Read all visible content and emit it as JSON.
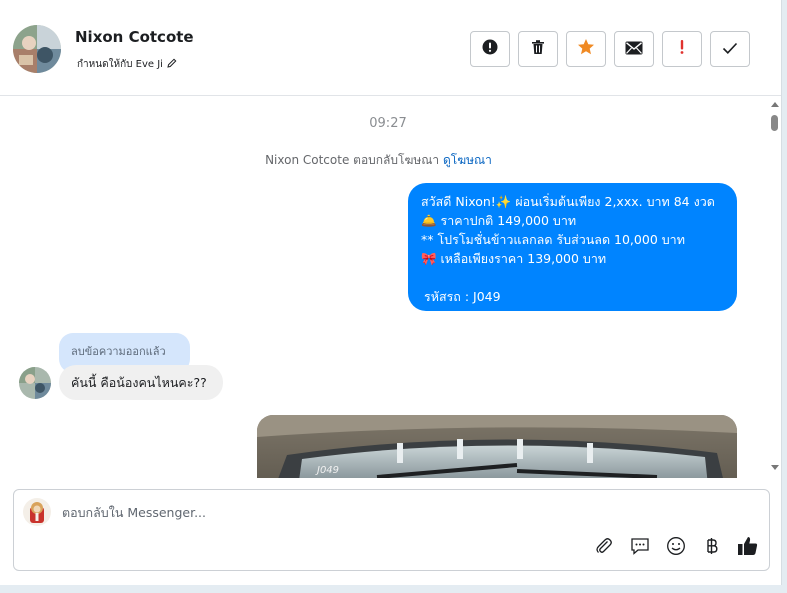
{
  "header": {
    "contact_name": "Nixon Cotcote",
    "assigned_text": "กำหนดให้กับ Eve Ji",
    "actions": [
      {
        "name": "mark-spam-icon",
        "color": "#1c1e21"
      },
      {
        "name": "trash-icon",
        "color": "#1c1e21"
      },
      {
        "name": "star-icon",
        "color": "#f08a24"
      },
      {
        "name": "envelope-icon",
        "color": "#1c1e21"
      },
      {
        "name": "follow-up-icon",
        "color": "#e0322e"
      },
      {
        "name": "checkmark-icon",
        "color": "#1c1e21"
      }
    ]
  },
  "chat": {
    "timestamp": "09:27",
    "notice_text": "Nixon Cotcote ตอบกลับโฆษณา",
    "notice_link": "ดูโฆษณา",
    "outgoing": {
      "line1": "สวัสดี Nixon!✨  ผ่อนเริ่มต้นเพียง 2,xxx. บาท 84 งวด",
      "line2": "🛎️ ราคาปกติ 149,000 บาท",
      "line3": "** โปรโมชั่นข้าวแลกลด รับส่วนลด 10,000 บาท",
      "line4": "🎀  เหลือเพียงราคา 139,000 บาท",
      "line5": "รหัสรถ : J049"
    },
    "deleted_label": "ลบข้อความออกแล้ว",
    "incoming_text": "คันนี้ คือน้องคนไหนคะ??",
    "image_plate_text": "J049"
  },
  "composer": {
    "placeholder": "ตอบกลับใน Messenger...",
    "tools": [
      "paperclip-icon",
      "chat-bubble-icon",
      "smiley-icon",
      "baht-icon",
      "thumbs-up-icon"
    ]
  },
  "colors": {
    "outgoing_bubble": "#0084ff",
    "deleted_bubble": "#d5e6fc",
    "incoming_bubble": "#f0f0f0",
    "link": "#0a66c2"
  }
}
